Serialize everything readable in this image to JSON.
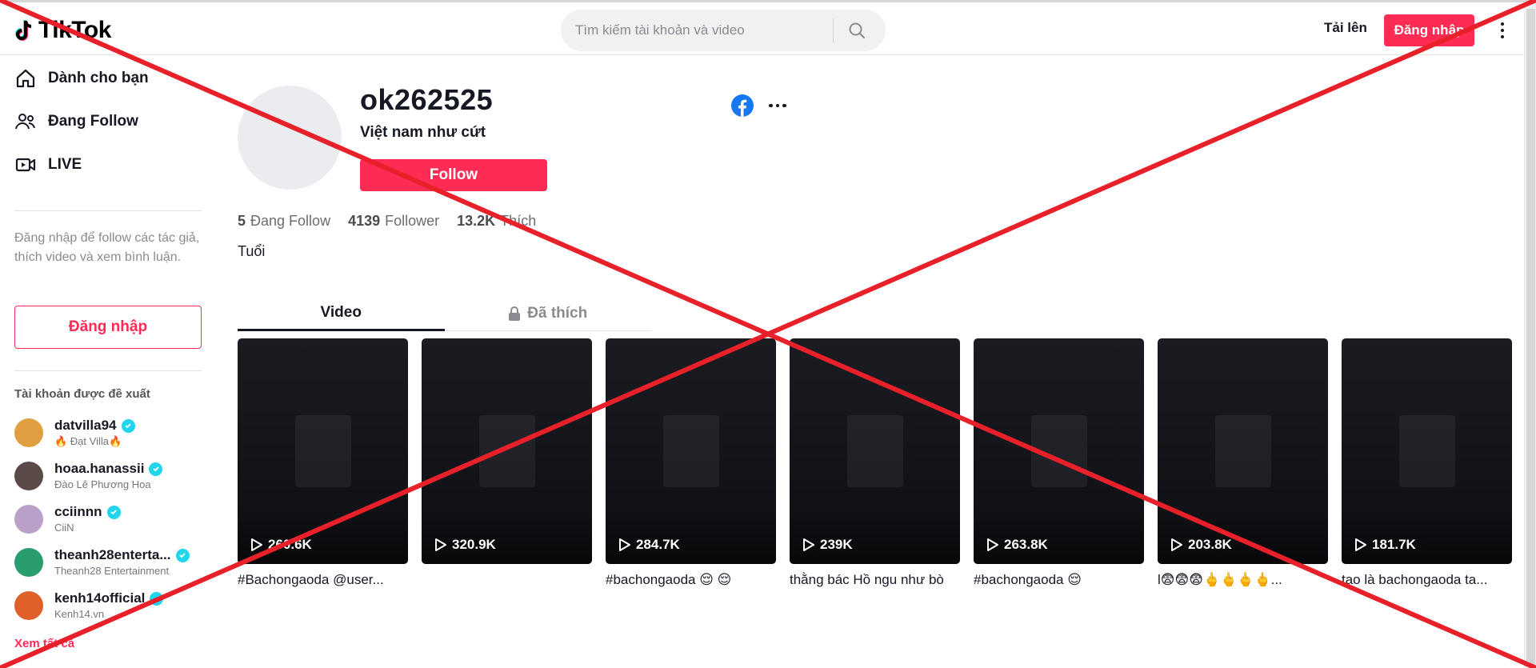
{
  "header": {
    "logo_text": "TikTok",
    "search": {
      "placeholder": "Tìm kiếm tài khoản và video",
      "value": ""
    },
    "upload_label": "Tải lên",
    "login_label": "Đăng nhập"
  },
  "sidebar": {
    "nav": [
      {
        "label": "Dành cho bạn",
        "icon": "home-icon"
      },
      {
        "label": "Đang Follow",
        "icon": "users-icon"
      },
      {
        "label": "LIVE",
        "icon": "live-video-icon"
      }
    ],
    "login_hint": "Đăng nhập để follow các tác giả, thích video và xem bình luận.",
    "login_button": "Đăng nhập",
    "suggested_title": "Tài khoản được đề xuất",
    "suggested": [
      {
        "username": "datvilla94",
        "display": "🔥 Đạt Villa🔥",
        "verified": true,
        "color": "#e0a040"
      },
      {
        "username": "hoaa.hanassii",
        "display": "Đào Lê Phương Hoa",
        "verified": true,
        "color": "#5a4a48"
      },
      {
        "username": "cciinnn",
        "display": "CiiN",
        "verified": true,
        "color": "#b8a0c8"
      },
      {
        "username": "theanh28enterta...",
        "display": "Theanh28 Entertainment",
        "verified": true,
        "color": "#2a9d6e"
      },
      {
        "username": "kenh14official",
        "display": "Kenh14.vn",
        "verified": true,
        "color": "#e0602a"
      }
    ],
    "see_all": "Xem tất cả"
  },
  "profile": {
    "username": "ok262525",
    "nickname": "Việt nam như cứt",
    "follow_label": "Follow",
    "stats": [
      {
        "value": "5",
        "label": "Đang Follow"
      },
      {
        "value": "4139",
        "label": "Follower"
      },
      {
        "value": "13.2K",
        "label": "Thích"
      }
    ],
    "bio": "Tuổi"
  },
  "tabs": [
    {
      "label": "Video",
      "active": true,
      "locked": false
    },
    {
      "label": "Đã thích",
      "active": false,
      "locked": true
    }
  ],
  "videos": [
    {
      "views": "260.6K",
      "caption": "#Bachongaoda @user..."
    },
    {
      "views": "320.9K",
      "caption": ""
    },
    {
      "views": "284.7K",
      "caption": "#bachongaoda 😌 😌"
    },
    {
      "views": "239K",
      "caption": "thằng bác Hồ ngu như bò"
    },
    {
      "views": "263.8K",
      "caption": "#bachongaoda 😌"
    },
    {
      "views": "203.8K",
      "caption": "l😨😨😨🖕🖕🖕🖕..."
    },
    {
      "views": "181.7K",
      "caption": "tao là bachongaoda ta..."
    }
  ],
  "colors": {
    "brand": "#fe2c55",
    "verified": "#20d5ec",
    "overlay_x": "#e8202a"
  }
}
